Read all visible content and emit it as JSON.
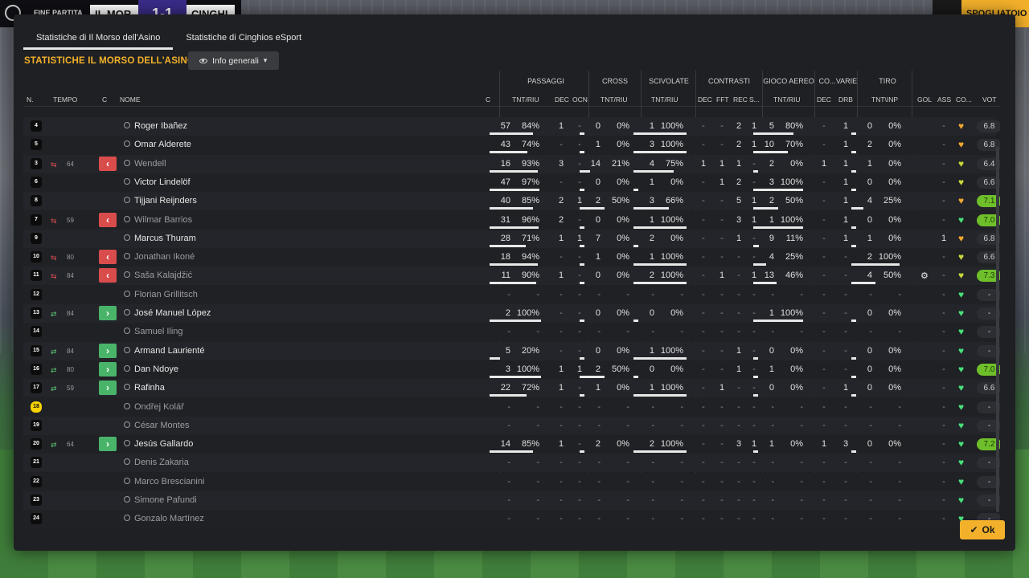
{
  "header": {
    "match_label": "FINE PARTITA",
    "team_home": "IL MOR",
    "score": "1-1",
    "team_away": "CINGHI",
    "right_button": "SPOGLIATOIO"
  },
  "tabs": [
    {
      "label": "Statistiche di Il Morso dell'Asino",
      "active": true
    },
    {
      "label": "Statistiche di Cinghios eSport",
      "active": false
    }
  ],
  "section_title": "STATISTICHE IL MORSO DELL'ASINO",
  "view_dropdown": "Info generali",
  "group_headers": [
    "PASSAGGI",
    "CROSS",
    "SCIVOLATE",
    "CONTRASTI",
    "GIOCO AEREO",
    "CO...",
    "VARIE",
    "TIRO"
  ],
  "column_headers": {
    "num": "N.",
    "time": "TEMPO",
    "c": "C",
    "name": "NOME",
    "c2": "C",
    "pass_tnt": "TNT/RIU",
    "pass_dec": "DEC",
    "pass_ocn": "OCN",
    "cross_tnt": "TNT/RIU",
    "sciv_tnt": "TNT/RIU",
    "con_dec": "DEC",
    "con_fft": "FFT",
    "con_rec": "REC",
    "con_s": "S...",
    "aereo_tnt": "TNT/RIU",
    "co_dec": "DEC",
    "varie_drb": "DRB",
    "tiro_tnt": "TNT\\INP",
    "gol": "GOL",
    "ass": "ASS",
    "co": "CO...",
    "vot": "VOT"
  },
  "players": [
    {
      "num": "4",
      "min": "",
      "sub": "",
      "name": "Roger Ibañez",
      "dim": false,
      "p": [
        "57",
        "84%"
      ],
      "pdec": "1",
      "pocn": "-",
      "cr": [
        "0",
        "0%"
      ],
      "sc": [
        "1",
        "100%"
      ],
      "c": [
        "-",
        "-",
        "2",
        "1"
      ],
      "ae": [
        "5",
        "80%"
      ],
      "cdec": "-",
      "drb": "1",
      "ti": [
        "0",
        "0%"
      ],
      "gol": "",
      "ass": "-",
      "mood": "orange",
      "vot": "6.8",
      "vothi": false
    },
    {
      "num": "5",
      "min": "",
      "sub": "",
      "name": "Omar Alderete",
      "dim": false,
      "p": [
        "43",
        "74%"
      ],
      "pdec": "-",
      "pocn": "-",
      "cr": [
        "1",
        "0%"
      ],
      "sc": [
        "3",
        "100%"
      ],
      "c": [
        "-",
        "-",
        "2",
        "1"
      ],
      "ae": [
        "10",
        "70%"
      ],
      "cdec": "-",
      "drb": "1",
      "ti": [
        "2",
        "0%"
      ],
      "gol": "",
      "ass": "-",
      "mood": "orange",
      "vot": "6.8",
      "vothi": false
    },
    {
      "num": "3",
      "min": "64",
      "sub": "out",
      "name": "Wendell",
      "dim": true,
      "p": [
        "16",
        "93%"
      ],
      "pdec": "3",
      "pocn": "-",
      "cr": [
        "14",
        "21%"
      ],
      "sc": [
        "4",
        "75%"
      ],
      "c": [
        "1",
        "1",
        "1",
        "-"
      ],
      "ae": [
        "2",
        "0%"
      ],
      "cdec": "1",
      "drb": "1",
      "ti": [
        "1",
        "0%"
      ],
      "gol": "",
      "ass": "-",
      "mood": "yellow",
      "vot": "6.4",
      "vothi": false
    },
    {
      "num": "6",
      "min": "",
      "sub": "",
      "name": "Victor Lindelöf",
      "dim": false,
      "p": [
        "47",
        "97%"
      ],
      "pdec": "-",
      "pocn": "-",
      "cr": [
        "0",
        "0%"
      ],
      "sc": [
        "1",
        "0%"
      ],
      "c": [
        "-",
        "1",
        "2",
        "-"
      ],
      "ae": [
        "3",
        "100%"
      ],
      "cdec": "-",
      "drb": "1",
      "ti": [
        "0",
        "0%"
      ],
      "gol": "",
      "ass": "-",
      "mood": "yellow",
      "vot": "6.6",
      "vothi": false
    },
    {
      "num": "8",
      "min": "",
      "sub": "",
      "name": "Tijjani Reijnders",
      "dim": false,
      "p": [
        "40",
        "85%"
      ],
      "pdec": "2",
      "pocn": "1",
      "cr": [
        "2",
        "50%"
      ],
      "sc": [
        "3",
        "66%"
      ],
      "c": [
        "-",
        "-",
        "5",
        "1"
      ],
      "ae": [
        "2",
        "50%"
      ],
      "cdec": "-",
      "drb": "1",
      "ti": [
        "4",
        "25%"
      ],
      "gol": "",
      "ass": "-",
      "mood": "orange",
      "vot": "7.1",
      "vothi": true
    },
    {
      "num": "7",
      "min": "59",
      "sub": "out",
      "name": "Wilmar Barrios",
      "dim": true,
      "p": [
        "31",
        "96%"
      ],
      "pdec": "2",
      "pocn": "-",
      "cr": [
        "0",
        "0%"
      ],
      "sc": [
        "1",
        "100%"
      ],
      "c": [
        "-",
        "-",
        "3",
        "1"
      ],
      "ae": [
        "1",
        "100%"
      ],
      "cdec": "-",
      "drb": "1",
      "ti": [
        "0",
        "0%"
      ],
      "gol": "",
      "ass": "-",
      "mood": "green",
      "vot": "7.0",
      "vothi": true
    },
    {
      "num": "9",
      "min": "",
      "sub": "",
      "name": "Marcus Thuram",
      "dim": false,
      "p": [
        "28",
        "71%"
      ],
      "pdec": "1",
      "pocn": "1",
      "cr": [
        "7",
        "0%"
      ],
      "sc": [
        "2",
        "0%"
      ],
      "c": [
        "-",
        "-",
        "1",
        "-"
      ],
      "ae": [
        "9",
        "11%"
      ],
      "cdec": "-",
      "drb": "1",
      "ti": [
        "1",
        "0%"
      ],
      "gol": "",
      "ass": "1",
      "mood": "orange",
      "vot": "6.8",
      "vothi": false
    },
    {
      "num": "10",
      "min": "80",
      "sub": "out",
      "name": "Jonathan Ikoné",
      "dim": true,
      "p": [
        "18",
        "94%"
      ],
      "pdec": "-",
      "pocn": "-",
      "cr": [
        "1",
        "0%"
      ],
      "sc": [
        "1",
        "100%"
      ],
      "c": [
        "-",
        "-",
        "-",
        "-"
      ],
      "ae": [
        "4",
        "25%"
      ],
      "cdec": "-",
      "drb": "-",
      "ti": [
        "2",
        "100%"
      ],
      "gol": "",
      "ass": "-",
      "mood": "yellow",
      "vot": "6.6",
      "vothi": false
    },
    {
      "num": "11",
      "min": "84",
      "sub": "out",
      "name": "Saša Kalajdžić",
      "dim": true,
      "p": [
        "11",
        "90%"
      ],
      "pdec": "1",
      "pocn": "-",
      "cr": [
        "0",
        "0%"
      ],
      "sc": [
        "2",
        "100%"
      ],
      "c": [
        "-",
        "1",
        "-",
        "1"
      ],
      "ae": [
        "13",
        "46%"
      ],
      "cdec": "-",
      "drb": "-",
      "ti": [
        "4",
        "50%"
      ],
      "gol": "gear",
      "ass": "-",
      "mood": "yellow",
      "vot": "7.3",
      "vothi": true
    },
    {
      "num": "12",
      "min": "",
      "sub": "",
      "name": "Florian Grillitsch",
      "dim": true,
      "p": [
        "-",
        "-"
      ],
      "pdec": "-",
      "pocn": "-",
      "cr": [
        "-",
        "-"
      ],
      "sc": [
        "-",
        "-"
      ],
      "c": [
        "-",
        "-",
        "-",
        "-"
      ],
      "ae": [
        "-",
        "-"
      ],
      "cdec": "-",
      "drb": "-",
      "ti": [
        "-",
        "-"
      ],
      "gol": "",
      "ass": "-",
      "mood": "green",
      "vot": "-",
      "vothi": false
    },
    {
      "num": "13",
      "min": "84",
      "sub": "in",
      "name": "José Manuel López",
      "dim": false,
      "p": [
        "2",
        "100%"
      ],
      "pdec": "-",
      "pocn": "-",
      "cr": [
        "0",
        "0%"
      ],
      "sc": [
        "0",
        "0%"
      ],
      "c": [
        "-",
        "-",
        "-",
        "-"
      ],
      "ae": [
        "1",
        "100%"
      ],
      "cdec": "-",
      "drb": "-",
      "ti": [
        "0",
        "0%"
      ],
      "gol": "",
      "ass": "-",
      "mood": "green",
      "vot": "-",
      "vothi": false
    },
    {
      "num": "14",
      "min": "",
      "sub": "",
      "name": "Samuel Iling",
      "dim": true,
      "p": [
        "-",
        "-"
      ],
      "pdec": "-",
      "pocn": "-",
      "cr": [
        "-",
        "-"
      ],
      "sc": [
        "-",
        "-"
      ],
      "c": [
        "-",
        "-",
        "-",
        "-"
      ],
      "ae": [
        "-",
        "-"
      ],
      "cdec": "-",
      "drb": "-",
      "ti": [
        "-",
        "-"
      ],
      "gol": "",
      "ass": "-",
      "mood": "green",
      "vot": "-",
      "vothi": false
    },
    {
      "num": "15",
      "min": "84",
      "sub": "in",
      "name": "Armand Laurienté",
      "dim": false,
      "p": [
        "5",
        "20%"
      ],
      "pdec": "-",
      "pocn": "-",
      "cr": [
        "0",
        "0%"
      ],
      "sc": [
        "1",
        "100%"
      ],
      "c": [
        "-",
        "-",
        "1",
        "-"
      ],
      "ae": [
        "0",
        "0%"
      ],
      "cdec": "-",
      "drb": "-",
      "ti": [
        "0",
        "0%"
      ],
      "gol": "",
      "ass": "-",
      "mood": "green",
      "vot": "-",
      "vothi": false
    },
    {
      "num": "16",
      "min": "80",
      "sub": "in",
      "name": "Dan Ndoye",
      "dim": false,
      "p": [
        "3",
        "100%"
      ],
      "pdec": "1",
      "pocn": "1",
      "cr": [
        "2",
        "50%"
      ],
      "sc": [
        "0",
        "0%"
      ],
      "c": [
        "-",
        "-",
        "1",
        "-"
      ],
      "ae": [
        "1",
        "0%"
      ],
      "cdec": "-",
      "drb": "-",
      "ti": [
        "0",
        "0%"
      ],
      "gol": "",
      "ass": "-",
      "mood": "green",
      "vot": "7.0",
      "vothi": true
    },
    {
      "num": "17",
      "min": "59",
      "sub": "in",
      "name": "Rafinha",
      "dim": false,
      "p": [
        "22",
        "72%"
      ],
      "pdec": "1",
      "pocn": "-",
      "cr": [
        "1",
        "0%"
      ],
      "sc": [
        "1",
        "100%"
      ],
      "c": [
        "-",
        "1",
        "-",
        "-"
      ],
      "ae": [
        "0",
        "0%"
      ],
      "cdec": "-",
      "drb": "1",
      "ti": [
        "0",
        "0%"
      ],
      "gol": "",
      "ass": "-",
      "mood": "green",
      "vot": "6.6",
      "vothi": false
    },
    {
      "num": "18",
      "min": "",
      "sub": "",
      "name": "Ondřej Kolář",
      "dim": true,
      "gk": true,
      "p": [
        "-",
        "-"
      ],
      "pdec": "-",
      "pocn": "-",
      "cr": [
        "-",
        "-"
      ],
      "sc": [
        "-",
        "-"
      ],
      "c": [
        "-",
        "-",
        "-",
        "-"
      ],
      "ae": [
        "-",
        "-"
      ],
      "cdec": "-",
      "drb": "-",
      "ti": [
        "-",
        "-"
      ],
      "gol": "",
      "ass": "-",
      "mood": "green",
      "vot": "-",
      "vothi": false
    },
    {
      "num": "19",
      "min": "",
      "sub": "",
      "name": "César Montes",
      "dim": true,
      "p": [
        "-",
        "-"
      ],
      "pdec": "-",
      "pocn": "-",
      "cr": [
        "-",
        "-"
      ],
      "sc": [
        "-",
        "-"
      ],
      "c": [
        "-",
        "-",
        "-",
        "-"
      ],
      "ae": [
        "-",
        "-"
      ],
      "cdec": "-",
      "drb": "-",
      "ti": [
        "-",
        "-"
      ],
      "gol": "",
      "ass": "-",
      "mood": "green",
      "vot": "-",
      "vothi": false
    },
    {
      "num": "20",
      "min": "64",
      "sub": "in",
      "name": "Jesús Gallardo",
      "dim": false,
      "p": [
        "14",
        "85%"
      ],
      "pdec": "1",
      "pocn": "-",
      "cr": [
        "2",
        "0%"
      ],
      "sc": [
        "2",
        "100%"
      ],
      "c": [
        "-",
        "-",
        "3",
        "1"
      ],
      "ae": [
        "1",
        "0%"
      ],
      "cdec": "1",
      "drb": "3",
      "ti": [
        "0",
        "0%"
      ],
      "gol": "",
      "ass": "-",
      "mood": "green",
      "vot": "7.2",
      "vothi": true
    },
    {
      "num": "21",
      "min": "",
      "sub": "",
      "name": "Denis Zakaria",
      "dim": true,
      "p": [
        "-",
        "-"
      ],
      "pdec": "-",
      "pocn": "-",
      "cr": [
        "-",
        "-"
      ],
      "sc": [
        "-",
        "-"
      ],
      "c": [
        "-",
        "-",
        "-",
        "-"
      ],
      "ae": [
        "-",
        "-"
      ],
      "cdec": "-",
      "drb": "-",
      "ti": [
        "-",
        "-"
      ],
      "gol": "",
      "ass": "-",
      "mood": "green",
      "vot": "-",
      "vothi": false
    },
    {
      "num": "22",
      "min": "",
      "sub": "",
      "name": "Marco Brescianini",
      "dim": true,
      "p": [
        "-",
        "-"
      ],
      "pdec": "-",
      "pocn": "-",
      "cr": [
        "-",
        "-"
      ],
      "sc": [
        "-",
        "-"
      ],
      "c": [
        "-",
        "-",
        "-",
        "-"
      ],
      "ae": [
        "-",
        "-"
      ],
      "cdec": "-",
      "drb": "-",
      "ti": [
        "-",
        "-"
      ],
      "gol": "",
      "ass": "-",
      "mood": "green",
      "vot": "-",
      "vothi": false
    },
    {
      "num": "23",
      "min": "",
      "sub": "",
      "name": "Simone Pafundi",
      "dim": true,
      "p": [
        "-",
        "-"
      ],
      "pdec": "-",
      "pocn": "-",
      "cr": [
        "-",
        "-"
      ],
      "sc": [
        "-",
        "-"
      ],
      "c": [
        "-",
        "-",
        "-",
        "-"
      ],
      "ae": [
        "-",
        "-"
      ],
      "cdec": "-",
      "drb": "-",
      "ti": [
        "-",
        "-"
      ],
      "gol": "",
      "ass": "-",
      "mood": "green",
      "vot": "-",
      "vothi": false
    },
    {
      "num": "24",
      "min": "",
      "sub": "",
      "name": "Gonzalo Martínez",
      "dim": true,
      "p": [
        "-",
        "-"
      ],
      "pdec": "-",
      "pocn": "-",
      "cr": [
        "-",
        "-"
      ],
      "sc": [
        "-",
        "-"
      ],
      "c": [
        "-",
        "-",
        "-",
        "-"
      ],
      "ae": [
        "-",
        "-"
      ],
      "cdec": "-",
      "drb": "-",
      "ti": [
        "-",
        "-"
      ],
      "gol": "",
      "ass": "-",
      "mood": "green",
      "vot": "-",
      "vothi": false
    }
  ],
  "ok_button": "Ok",
  "colors": {
    "accent": "#f3b12b",
    "out": "#d94c4c",
    "in": "#4ab36a",
    "vote_high": "#6fbf2b"
  }
}
